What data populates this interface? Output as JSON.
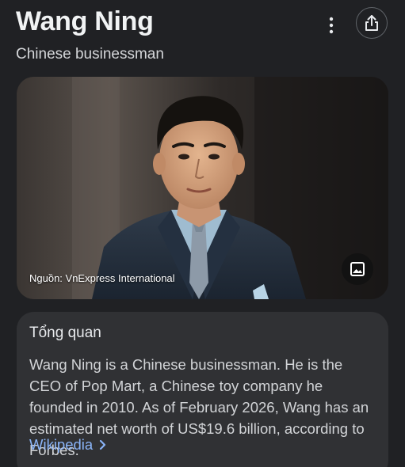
{
  "header": {
    "title": "Wang Ning",
    "subtitle": "Chinese businessman",
    "menu_icon": "more-vert-icon",
    "share_icon": "share-icon"
  },
  "photo": {
    "credit": "Nguồn: VnExpress International",
    "image_icon": "image-icon"
  },
  "overview": {
    "heading": "Tổng quan",
    "text": "Wang Ning is a Chinese businessman. He is the CEO of Pop Mart, a Chinese toy company he founded in 2010. As of February 2026, Wang has an estimated net worth of US$19.6 billion, according to Forbes.",
    "source_link": "Wikipedia",
    "link_icon": "chevron-right-icon"
  },
  "colors": {
    "background": "#202124",
    "card": "#303134",
    "link": "#8ab4f8"
  }
}
